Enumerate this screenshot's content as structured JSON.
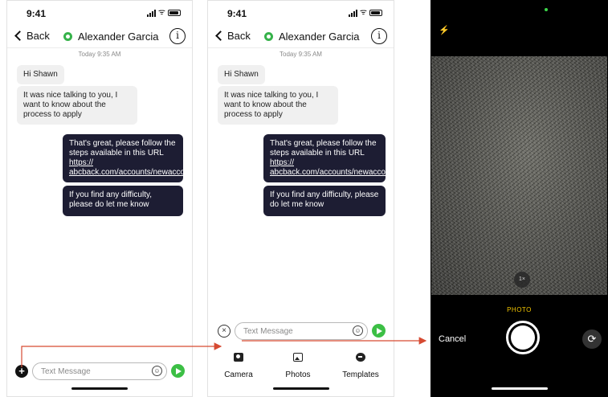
{
  "status": {
    "time": "9:41"
  },
  "header": {
    "back_label": "Back",
    "contact_name": "Alexander Garcia",
    "info_glyph": "i"
  },
  "chat": {
    "timestamp": "Today 9:35 AM",
    "incoming": [
      "Hi Shawn",
      "It was nice talking to you, I want to know about the process to apply"
    ],
    "outgoing_1_text": "That's great, please follow the steps available in this URL",
    "outgoing_1_link": "https:// abcback.com/accounts/newaccount/process.html",
    "outgoing_2": "If you find any difficulty, please do let me know"
  },
  "composer": {
    "placeholder": "Text Message",
    "plus_glyph": "+",
    "close_glyph": "×",
    "emoji_glyph": "☺"
  },
  "attach_actions": [
    {
      "label": "Camera",
      "icon": "camera-icon"
    },
    {
      "label": "Photos",
      "icon": "photos-icon"
    },
    {
      "label": "Templates",
      "icon": "templates-icon"
    }
  ],
  "camera": {
    "flash_glyph": "⚡",
    "zoom": "1×",
    "mode": "PHOTO",
    "cancel": "Cancel",
    "flip_glyph": "⟳"
  },
  "colors": {
    "outgoing_bubble": "#1d1d33",
    "incoming_bubble": "#f0f0f0",
    "send": "#3cbf45",
    "arrow": "#d64a32",
    "photo_mode": "#f2c500"
  }
}
